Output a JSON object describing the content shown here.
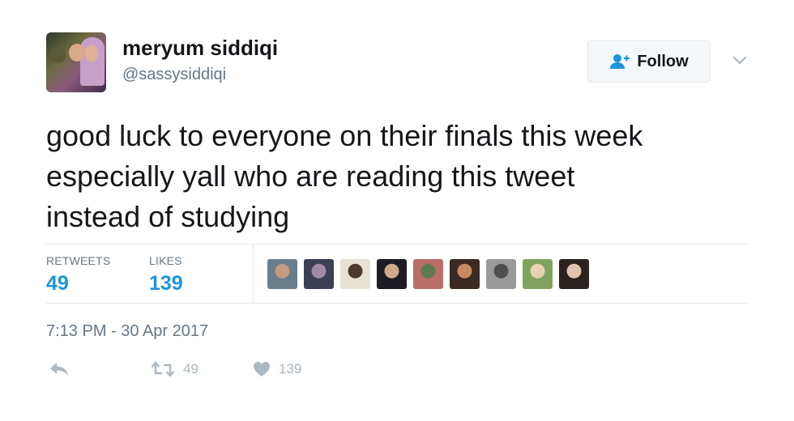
{
  "user": {
    "display_name": "meryum siddiqi",
    "handle": "@sassysiddiqi"
  },
  "follow_button": {
    "label": "Follow",
    "icon": "add-user-icon"
  },
  "tweet": {
    "lines": [
      "good luck to everyone on their finals this week",
      "especially yall who are reading this tweet",
      "instead of studying"
    ]
  },
  "stats": {
    "retweets_label": "RETWEETS",
    "retweets_count": "49",
    "likes_label": "LIKES",
    "likes_count": "139"
  },
  "likers": [
    {
      "colors": [
        "#6a7d8a",
        "#c49a80"
      ]
    },
    {
      "colors": [
        "#3c3f56",
        "#a08aa8"
      ]
    },
    {
      "colors": [
        "#e8e2d6",
        "#4a3b2e"
      ]
    },
    {
      "colors": [
        "#1c1c22",
        "#d0a88a"
      ]
    },
    {
      "colors": [
        "#b96e6a",
        "#5f7a4e"
      ]
    },
    {
      "colors": [
        "#3a2a22",
        "#c58a62"
      ]
    },
    {
      "colors": [
        "#9a9a9a",
        "#4e4e4e"
      ]
    },
    {
      "colors": [
        "#7fa35e",
        "#e6d2b4"
      ]
    },
    {
      "colors": [
        "#2b2320",
        "#e0c4b0"
      ]
    }
  ],
  "timestamp": "7:13 PM - 30 Apr 2017",
  "actions": {
    "reply_icon": "reply-icon",
    "retweet_icon": "retweet-icon",
    "retweet_count": "49",
    "like_icon": "heart-icon",
    "like_count": "139"
  },
  "colors": {
    "accent": "#1b95e0",
    "muted": "#657786",
    "action": "#aab8c2",
    "divider": "#e1e8ed"
  }
}
